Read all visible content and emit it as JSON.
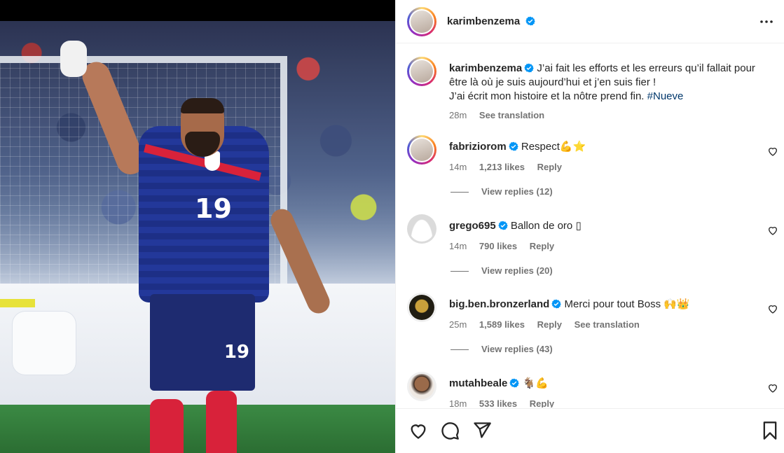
{
  "post": {
    "author": "karimbenzema",
    "author_verified": true
  },
  "caption": {
    "username": "karimbenzema",
    "text": "J’ai fait les efforts et les erreurs qu’il fallait pour être là où je suis aujourd’hui et j’en suis fier !",
    "text2": "J’ai écrit mon histoire et la nôtre prend fin.",
    "hashtag": "#Nueve",
    "time": "28m",
    "see_translation": "See translation"
  },
  "photo": {
    "jersey_number": "19",
    "shorts_number": "19"
  },
  "comments": [
    {
      "username": "fabriziorom",
      "text": "Respect💪⭐",
      "time": "14m",
      "likes": "1,213 likes",
      "reply": "Reply",
      "view_replies": "View replies (12)"
    },
    {
      "username": "grego695",
      "text": "Ballon de oro ▯",
      "time": "14m",
      "likes": "790 likes",
      "reply": "Reply",
      "view_replies": "View replies (20)"
    },
    {
      "username": "big.ben.bronzerland",
      "text": "Merci pour tout Boss 🙌👑",
      "time": "25m",
      "likes": "1,589 likes",
      "reply": "Reply",
      "see_translation": "See translation",
      "view_replies": "View replies (43)"
    },
    {
      "username": "mutahbeale",
      "text": "🐐💪",
      "time": "18m",
      "likes": "533 likes",
      "reply": "Reply"
    }
  ],
  "icons": {
    "more": "more-options-icon",
    "verified": "verified-badge-icon",
    "like": "heart-icon",
    "comment": "comment-icon",
    "share": "send-icon",
    "save": "bookmark-icon"
  },
  "colors": {
    "verified": "#0095f6",
    "text": "#262626",
    "secondary": "#737373",
    "hashtag": "#00376b"
  }
}
